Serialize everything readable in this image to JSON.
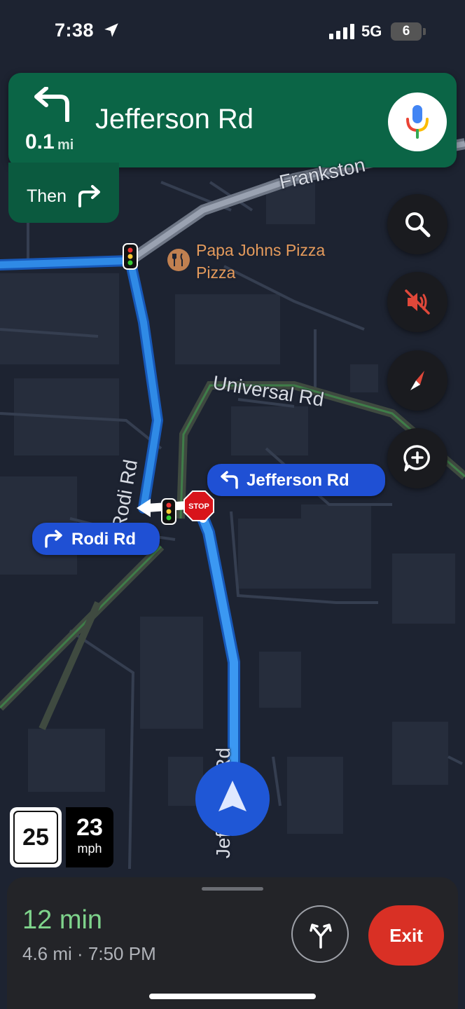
{
  "status_bar": {
    "time": "7:38",
    "network": "5G",
    "battery": "6"
  },
  "navigation": {
    "distance": "0.1",
    "distance_unit": "mi",
    "street": "Jefferson Rd",
    "then_label": "Then",
    "maneuver_icon": "turn-left-arrow",
    "then_icon": "turn-right-arrow"
  },
  "map": {
    "road_labels": {
      "frankston": "Frankston",
      "universal": "Universal Rd",
      "rodi_vertical": "Rodi Rd",
      "jefferson_vertical": "Jefferson Rd"
    },
    "poi": {
      "name": "Papa Johns Pizza",
      "category": "Pizza"
    },
    "callouts": {
      "left": "Jefferson Rd",
      "right": "Rodi Rd"
    },
    "stop_sign": "STOP"
  },
  "controls": [
    "search-icon",
    "mute-icon",
    "compass-icon",
    "report-add-icon"
  ],
  "speed": {
    "limit": "25",
    "current": "23",
    "unit": "mph"
  },
  "trip": {
    "duration": "12 min",
    "details": "4.6 mi · 7:50 PM",
    "exit_label": "Exit"
  },
  "colors": {
    "banner": "#0b6546",
    "route": "#2f8ae6",
    "callout": "#1f50d4",
    "eta": "#7fd48c",
    "exit": "#d93025"
  }
}
